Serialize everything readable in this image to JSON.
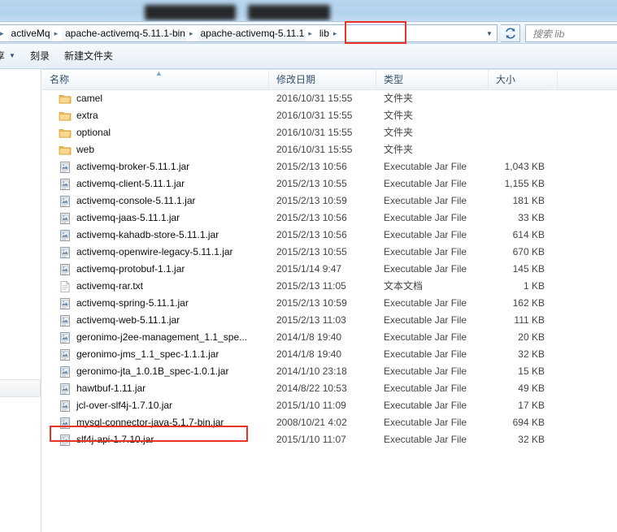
{
  "window": {
    "title_redacted": true
  },
  "address_bar": {
    "breadcrumbs": [
      {
        "label": "activeMq",
        "highlighted": false
      },
      {
        "label": "apache-activemq-5.11.1-bin",
        "highlighted": false
      },
      {
        "label": "apache-activemq-5.11.1",
        "highlighted": false
      },
      {
        "label": "lib",
        "highlighted": true
      }
    ],
    "separator": "▸",
    "dropdown_icon": "chevron-down-icon",
    "refresh_icon": "refresh-icon",
    "refresh_glyph": "↻"
  },
  "search": {
    "placeholder": "搜索 lib",
    "value": ""
  },
  "toolbar": {
    "items": [
      {
        "label": "享",
        "has_caret": true,
        "name": "share-menu"
      },
      {
        "label": "刻录",
        "has_caret": false,
        "name": "burn-button"
      },
      {
        "label": "新建文件夹",
        "has_caret": false,
        "name": "new-folder-button"
      }
    ]
  },
  "columns": [
    {
      "key": "name",
      "label": "名称",
      "sorted": true,
      "sort_glyph": "▲"
    },
    {
      "key": "date",
      "label": "修改日期",
      "sorted": false
    },
    {
      "key": "type",
      "label": "类型",
      "sorted": false
    },
    {
      "key": "size",
      "label": "大小",
      "sorted": false
    },
    {
      "key": "extra",
      "label": "",
      "sorted": false
    }
  ],
  "files": [
    {
      "name": "camel",
      "date": "2016/10/31 15:55",
      "type": "文件夹",
      "size": "",
      "icon": "folder-icon"
    },
    {
      "name": "extra",
      "date": "2016/10/31 15:55",
      "type": "文件夹",
      "size": "",
      "icon": "folder-icon"
    },
    {
      "name": "optional",
      "date": "2016/10/31 15:55",
      "type": "文件夹",
      "size": "",
      "icon": "folder-icon"
    },
    {
      "name": "web",
      "date": "2016/10/31 15:55",
      "type": "文件夹",
      "size": "",
      "icon": "folder-icon"
    },
    {
      "name": "activemq-broker-5.11.1.jar",
      "date": "2015/2/13 10:56",
      "type": "Executable Jar File",
      "size": "1,043 KB",
      "icon": "jar-icon"
    },
    {
      "name": "activemq-client-5.11.1.jar",
      "date": "2015/2/13 10:55",
      "type": "Executable Jar File",
      "size": "1,155 KB",
      "icon": "jar-icon"
    },
    {
      "name": "activemq-console-5.11.1.jar",
      "date": "2015/2/13 10:59",
      "type": "Executable Jar File",
      "size": "181 KB",
      "icon": "jar-icon"
    },
    {
      "name": "activemq-jaas-5.11.1.jar",
      "date": "2015/2/13 10:56",
      "type": "Executable Jar File",
      "size": "33 KB",
      "icon": "jar-icon"
    },
    {
      "name": "activemq-kahadb-store-5.11.1.jar",
      "date": "2015/2/13 10:56",
      "type": "Executable Jar File",
      "size": "614 KB",
      "icon": "jar-icon"
    },
    {
      "name": "activemq-openwire-legacy-5.11.1.jar",
      "date": "2015/2/13 10:55",
      "type": "Executable Jar File",
      "size": "670 KB",
      "icon": "jar-icon"
    },
    {
      "name": "activemq-protobuf-1.1.jar",
      "date": "2015/1/14 9:47",
      "type": "Executable Jar File",
      "size": "145 KB",
      "icon": "jar-icon"
    },
    {
      "name": "activemq-rar.txt",
      "date": "2015/2/13 11:05",
      "type": "文本文档",
      "size": "1 KB",
      "icon": "text-file-icon"
    },
    {
      "name": "activemq-spring-5.11.1.jar",
      "date": "2015/2/13 10:59",
      "type": "Executable Jar File",
      "size": "162 KB",
      "icon": "jar-icon"
    },
    {
      "name": "activemq-web-5.11.1.jar",
      "date": "2015/2/13 11:03",
      "type": "Executable Jar File",
      "size": "111 KB",
      "icon": "jar-icon"
    },
    {
      "name": "geronimo-j2ee-management_1.1_spe...",
      "date": "2014/1/8 19:40",
      "type": "Executable Jar File",
      "size": "20 KB",
      "icon": "jar-icon"
    },
    {
      "name": "geronimo-jms_1.1_spec-1.1.1.jar",
      "date": "2014/1/8 19:40",
      "type": "Executable Jar File",
      "size": "32 KB",
      "icon": "jar-icon"
    },
    {
      "name": "geronimo-jta_1.0.1B_spec-1.0.1.jar",
      "date": "2014/1/10 23:18",
      "type": "Executable Jar File",
      "size": "15 KB",
      "icon": "jar-icon"
    },
    {
      "name": "hawtbuf-1.11.jar",
      "date": "2014/8/22 10:53",
      "type": "Executable Jar File",
      "size": "49 KB",
      "icon": "jar-icon"
    },
    {
      "name": "jcl-over-slf4j-1.7.10.jar",
      "date": "2015/1/10 11:09",
      "type": "Executable Jar File",
      "size": "17 KB",
      "icon": "jar-icon"
    },
    {
      "name": "mysql-connector-java-5.1.7-bin.jar",
      "date": "2008/10/21 4:02",
      "type": "Executable Jar File",
      "size": "694 KB",
      "icon": "jar-icon"
    },
    {
      "name": "slf4j-api-1.7.10.jar",
      "date": "2015/1/10 11:07",
      "type": "Executable Jar File",
      "size": "32 KB",
      "icon": "jar-icon"
    }
  ],
  "annotations": [
    {
      "name": "lib-breadcrumb-highlight",
      "target": "lib",
      "color": "#ea3323"
    },
    {
      "name": "mysql-connector-highlight",
      "target": "mysql-connector-java-5.1.7-bin.jar",
      "color": "#ea3323"
    }
  ],
  "colors": {
    "annotation_red": "#ea3323",
    "chrome_blue": "#b3d2ed",
    "folder_yellow": "#f5c462"
  }
}
